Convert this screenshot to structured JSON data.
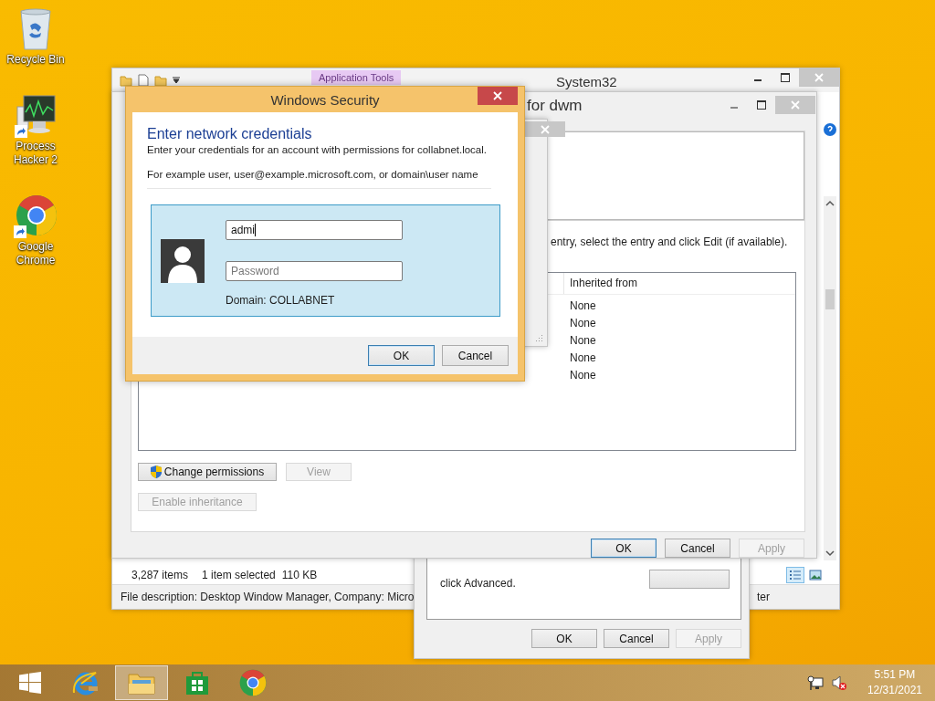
{
  "desktop_icons": [
    {
      "kind": "recycle",
      "label": "Recycle Bin",
      "shortcut": false
    },
    {
      "kind": "monitor",
      "label": "Process Hacker 2",
      "shortcut": true
    },
    {
      "kind": "chrome",
      "label": "Google Chrome",
      "shortcut": true
    }
  ],
  "explorer": {
    "title": "System32",
    "ribbon_tab": "Application Tools",
    "status": [
      "3,287 items",
      "1 item selected",
      "110 KB"
    ],
    "details": "File description: Desktop Window Manager, Company: Micro",
    "details_end": "ter",
    "views": [
      {
        "kind": "details",
        "selected": true
      },
      {
        "kind": "large",
        "selected": false
      }
    ]
  },
  "properties": {
    "text": "click Advanced.",
    "buttons": [
      {
        "label": "OK",
        "default": false,
        "disabled": false
      },
      {
        "label": "Cancel",
        "default": false,
        "disabled": false
      },
      {
        "label": "Apply",
        "default": false,
        "disabled": true
      }
    ]
  },
  "security": {
    "title": "for dwm",
    "instruction": "entry, select the entry and click Edit (if available).",
    "table": {
      "columns": [
        "Inherited from"
      ],
      "rows": [
        [
          "None"
        ],
        [
          "None"
        ],
        [
          "None"
        ],
        [
          "None"
        ],
        [
          "None"
        ]
      ]
    },
    "actions": [
      {
        "label": "Change permissions",
        "shield": true,
        "disabled": false
      },
      {
        "label": "View",
        "shield": false,
        "disabled": true
      },
      {
        "label": "Enable inheritance",
        "shield": false,
        "disabled": true
      }
    ],
    "buttons": [
      {
        "label": "OK",
        "default": true,
        "disabled": false
      },
      {
        "label": "Cancel",
        "default": false,
        "disabled": false
      },
      {
        "label": "Apply",
        "default": false,
        "disabled": true
      }
    ]
  },
  "credentials": {
    "title": "Windows Security",
    "heading": "Enter network credentials",
    "message": "Enter your credentials for an account with permissions for collabnet.local.",
    "example": "For example user, user@example.microsoft.com, or domain\\user name",
    "username": "admi",
    "password_placeholder": "Password",
    "domain": "Domain: COLLABNET",
    "buttons": [
      {
        "label": "OK",
        "default": true,
        "disabled": false
      },
      {
        "label": "Cancel",
        "default": false,
        "disabled": false
      }
    ]
  },
  "taskbar": {
    "apps": [
      {
        "kind": "start",
        "selected": false
      },
      {
        "kind": "ie",
        "selected": false
      },
      {
        "kind": "explorer",
        "selected": true
      },
      {
        "kind": "store",
        "selected": false
      },
      {
        "kind": "chrome",
        "selected": false
      }
    ],
    "sound_muted": true,
    "time": "5:51 PM",
    "date": "12/31/2021"
  }
}
